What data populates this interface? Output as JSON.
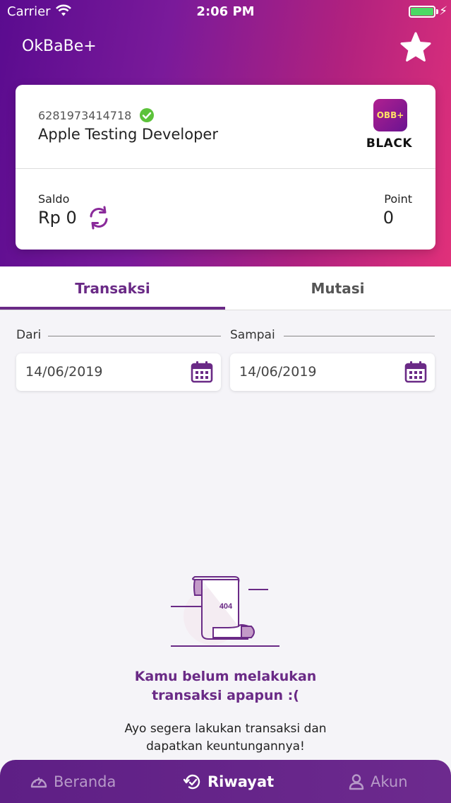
{
  "status_bar": {
    "carrier": "Carrier",
    "time": "2:06 PM"
  },
  "header": {
    "title": "OkBaBe+",
    "favorite_icon": "star-icon"
  },
  "account_card": {
    "phone": "6281973414718",
    "name": "Apple Testing Developer",
    "badge_text": "OBB+",
    "tier": "BLACK",
    "saldo_label": "Saldo",
    "saldo_value": "Rp 0",
    "point_label": "Point",
    "point_value": "0"
  },
  "tabs": [
    {
      "label": "Transaksi",
      "active": true
    },
    {
      "label": "Mutasi",
      "active": false
    }
  ],
  "date_filter": {
    "from_label": "Dari",
    "from_value": "14/06/2019",
    "to_label": "Sampai",
    "to_value": "14/06/2019"
  },
  "empty_state": {
    "code": "404",
    "title_line1": "Kamu belum melakukan",
    "title_line2": "transaksi apapun :(",
    "subtitle_line1": "Ayo segera lakukan transaksi dan",
    "subtitle_line2": "dapatkan keuntungannya!"
  },
  "bottom_nav": [
    {
      "label": "Beranda",
      "icon": "speedometer-icon",
      "active": false
    },
    {
      "label": "Riwayat",
      "icon": "history-icon",
      "active": true
    },
    {
      "label": "Akun",
      "icon": "user-icon",
      "active": false
    }
  ],
  "colors": {
    "accent": "#6a2a86",
    "gradient_start": "#5a0b8f",
    "gradient_end": "#e0307a",
    "verified": "#5cc23a"
  }
}
